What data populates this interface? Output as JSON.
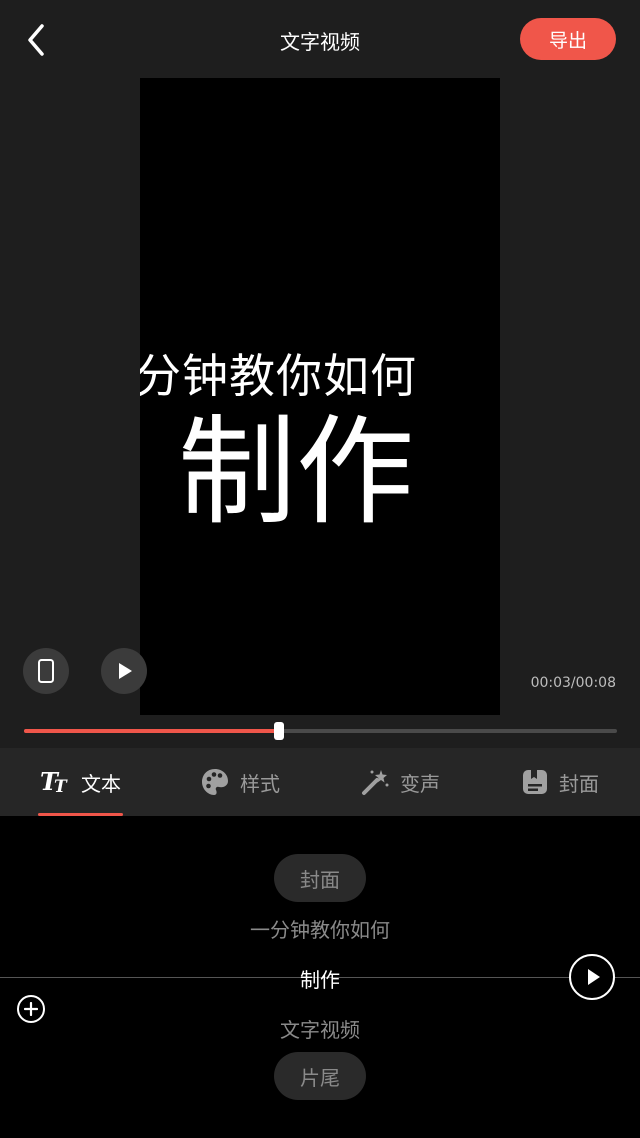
{
  "header": {
    "title": "文字视频",
    "export_label": "导出",
    "back_icon": "chevron-left-icon"
  },
  "preview": {
    "line1": "分钟教你如何",
    "line2": "制作",
    "timecode": "00:03/00:08",
    "progress": 0.43
  },
  "tabs": [
    {
      "label": "文本",
      "icon": "text-format-icon",
      "active": true
    },
    {
      "label": "样式",
      "icon": "palette-icon",
      "active": false
    },
    {
      "label": "变声",
      "icon": "magic-wand-icon",
      "active": false
    },
    {
      "label": "封面",
      "icon": "cover-icon",
      "active": false
    }
  ],
  "script_list": {
    "cover": "封面",
    "line1": "一分钟教你如何",
    "current": "制作",
    "line3": "文字视频",
    "ending": "片尾"
  },
  "colors": {
    "accent": "#f0564a",
    "background": "#1e1e1e",
    "panel": "#000000"
  }
}
